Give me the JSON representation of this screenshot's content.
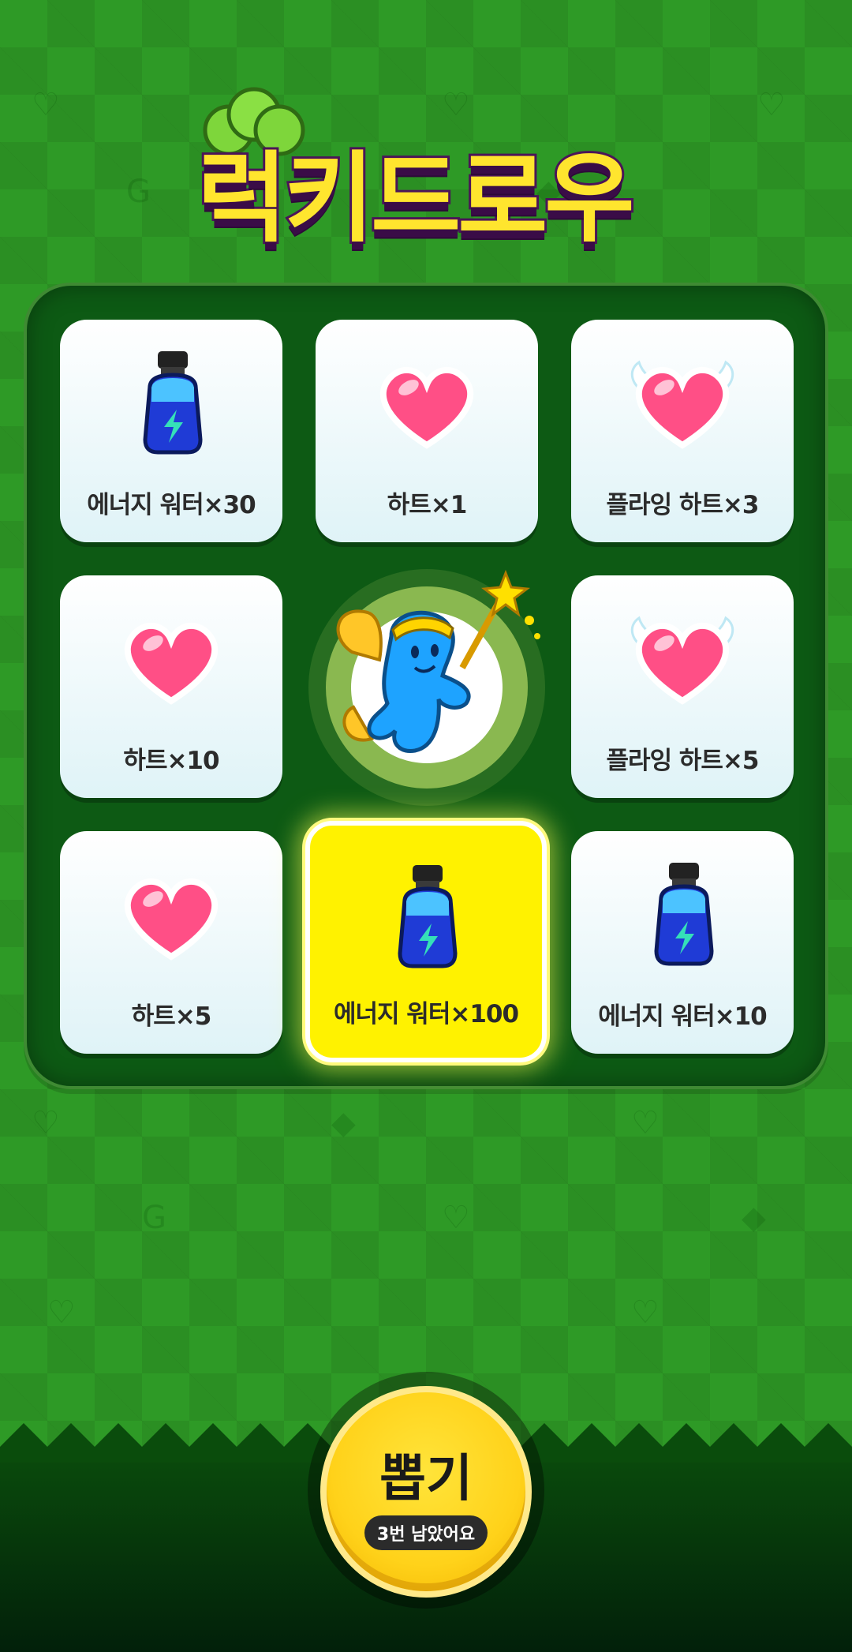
{
  "title": "럭키드로우",
  "prizes": [
    {
      "label": "에너지 워터×30",
      "icon": "energy-water-icon"
    },
    {
      "label": "하트×1",
      "icon": "heart-icon"
    },
    {
      "label": "플라잉 하트×3",
      "icon": "flying-heart-icon"
    },
    {
      "label": "하트×10",
      "icon": "heart-icon"
    },
    {
      "label": "플라잉 하트×5",
      "icon": "flying-heart-icon"
    },
    {
      "label": "하트×5",
      "icon": "heart-icon"
    },
    {
      "label": "에너지 워터×100",
      "icon": "energy-water-icon",
      "selected": true
    },
    {
      "label": "에너지 워터×10",
      "icon": "energy-water-icon"
    }
  ],
  "draw_button": {
    "label": "뽑기",
    "remaining": "3번 남았어요"
  },
  "colors": {
    "background": "#2e9a26",
    "board": "#0d5a14",
    "highlight": "#fff200",
    "button": "#ffd21a",
    "title": "#ffe52e",
    "title_outline": "#4b1458"
  }
}
